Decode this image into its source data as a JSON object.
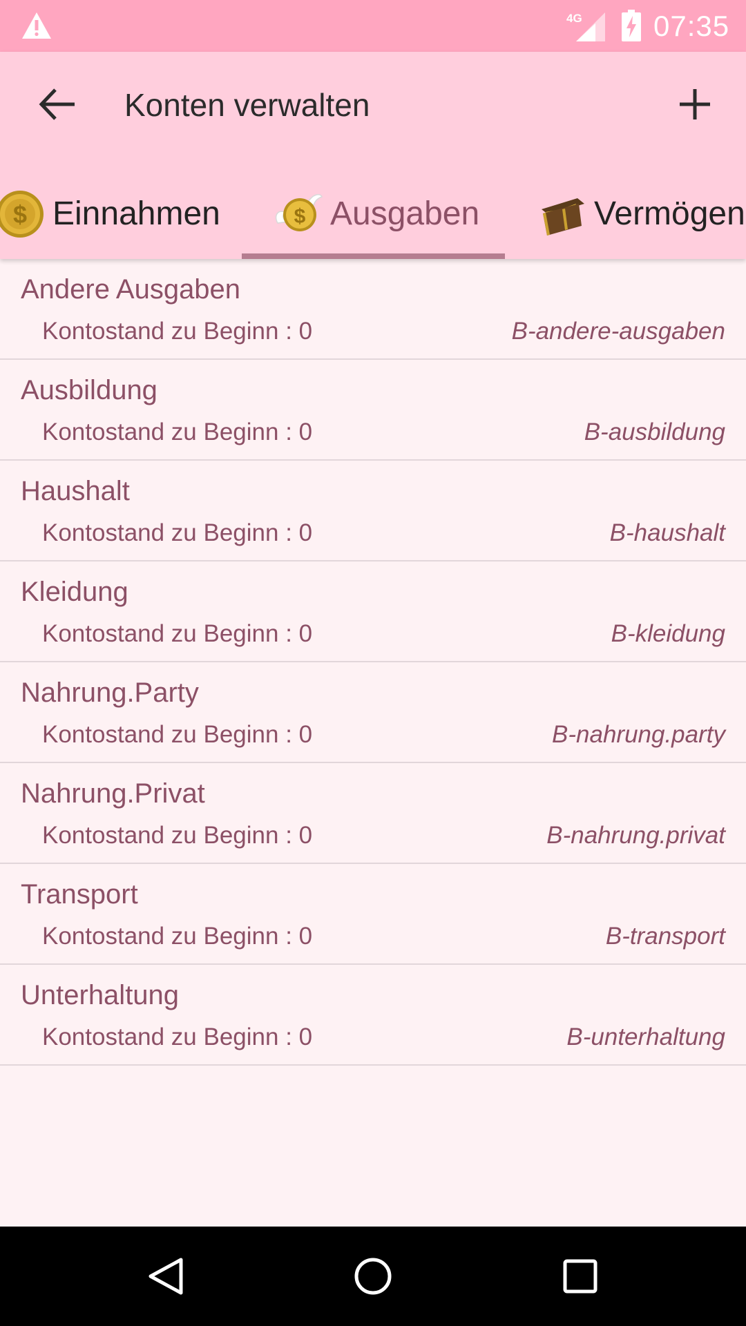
{
  "status_bar": {
    "network": "4G",
    "time": "07:35"
  },
  "app_bar": {
    "title": "Konten verwalten"
  },
  "tabs": [
    {
      "label": "Einnahmen",
      "icon": "gold-coin-icon",
      "active": false
    },
    {
      "label": "Ausgaben",
      "icon": "winged-coin-icon",
      "active": true
    },
    {
      "label": "Vermögen",
      "icon": "treasure-chest-icon",
      "active": false
    }
  ],
  "accounts": [
    {
      "name": "Andere Ausgaben",
      "balance": "Kontostand zu Beginn : 0",
      "code": "B-andere-ausgaben"
    },
    {
      "name": "Ausbildung",
      "balance": "Kontostand zu Beginn : 0",
      "code": "B-ausbildung"
    },
    {
      "name": "Haushalt",
      "balance": "Kontostand zu Beginn : 0",
      "code": "B-haushalt"
    },
    {
      "name": "Kleidung",
      "balance": "Kontostand zu Beginn : 0",
      "code": "B-kleidung"
    },
    {
      "name": "Nahrung.Party",
      "balance": "Kontostand zu Beginn : 0",
      "code": "B-nahrung.party"
    },
    {
      "name": "Nahrung.Privat",
      "balance": "Kontostand zu Beginn : 0",
      "code": "B-nahrung.privat"
    },
    {
      "name": "Transport",
      "balance": "Kontostand zu Beginn : 0",
      "code": "B-transport"
    },
    {
      "name": "Unterhaltung",
      "balance": "Kontostand zu Beginn : 0",
      "code": "B-unterhaltung"
    }
  ],
  "colors": {
    "status_bar": "#ffa6c0",
    "app_bar": "#ffcedd",
    "background": "#fef2f4",
    "accent_text": "#8c5066",
    "tab_indicator": "#b57d90"
  }
}
